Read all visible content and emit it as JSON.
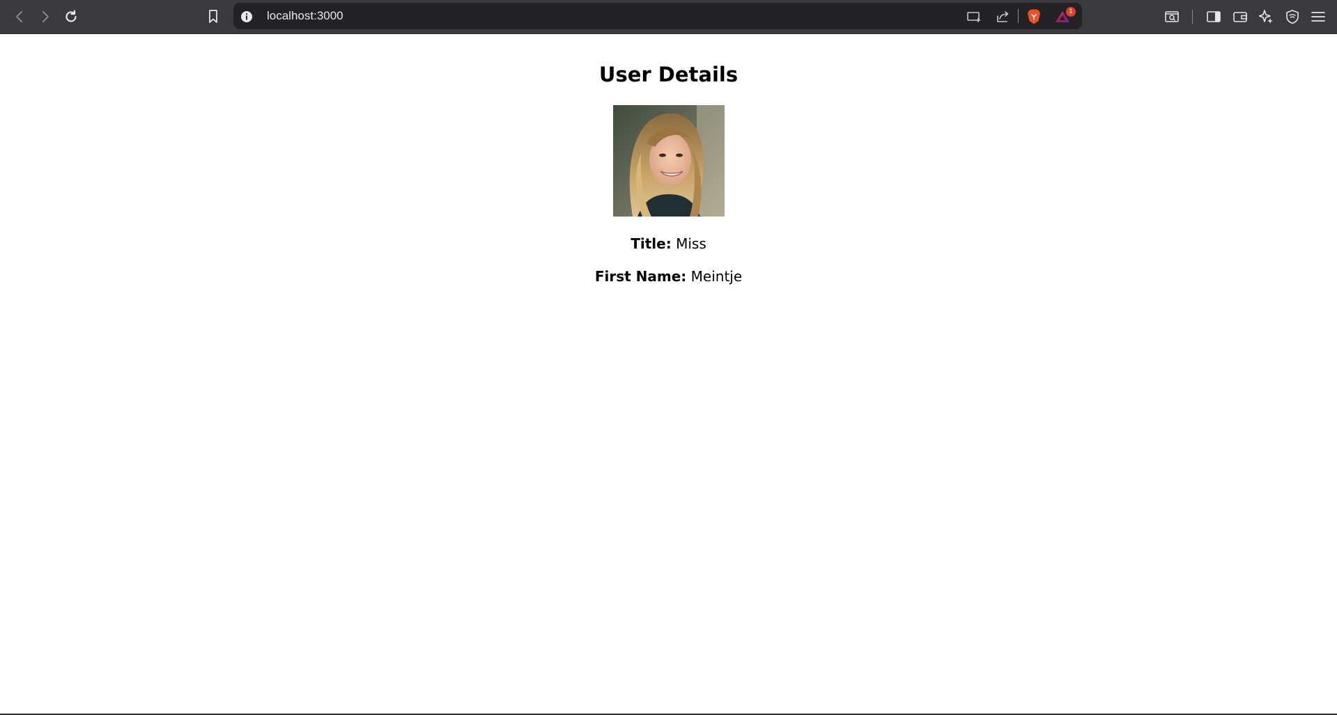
{
  "browser": {
    "url": "localhost:3000",
    "notification_count": "1",
    "icons": {
      "back": "chevron-left-icon",
      "forward": "chevron-right-icon",
      "reload": "reload-icon",
      "bookmark": "bookmark-icon",
      "info": "info-icon",
      "cast": "cast-icon",
      "share": "share-icon",
      "brave_shield": "brave-lion-icon",
      "brave_rewards": "rewards-triangle-icon",
      "reader": "reader-mode-icon",
      "sidebar": "sidebar-icon",
      "wallet": "wallet-icon",
      "leo": "leo-ai-icon",
      "vpn": "vpn-shield-icon",
      "menu": "hamburger-menu-icon"
    },
    "colors": {
      "chrome_bg": "#3a3a3e",
      "urlbar_bg": "#232327",
      "brave_orange": "#f04e23",
      "badge_red": "#e0412c"
    }
  },
  "page": {
    "heading": "User Details",
    "fields": [
      {
        "label": "Title:",
        "value": "Miss"
      },
      {
        "label": "First Name:",
        "value": "Meintje"
      }
    ]
  }
}
